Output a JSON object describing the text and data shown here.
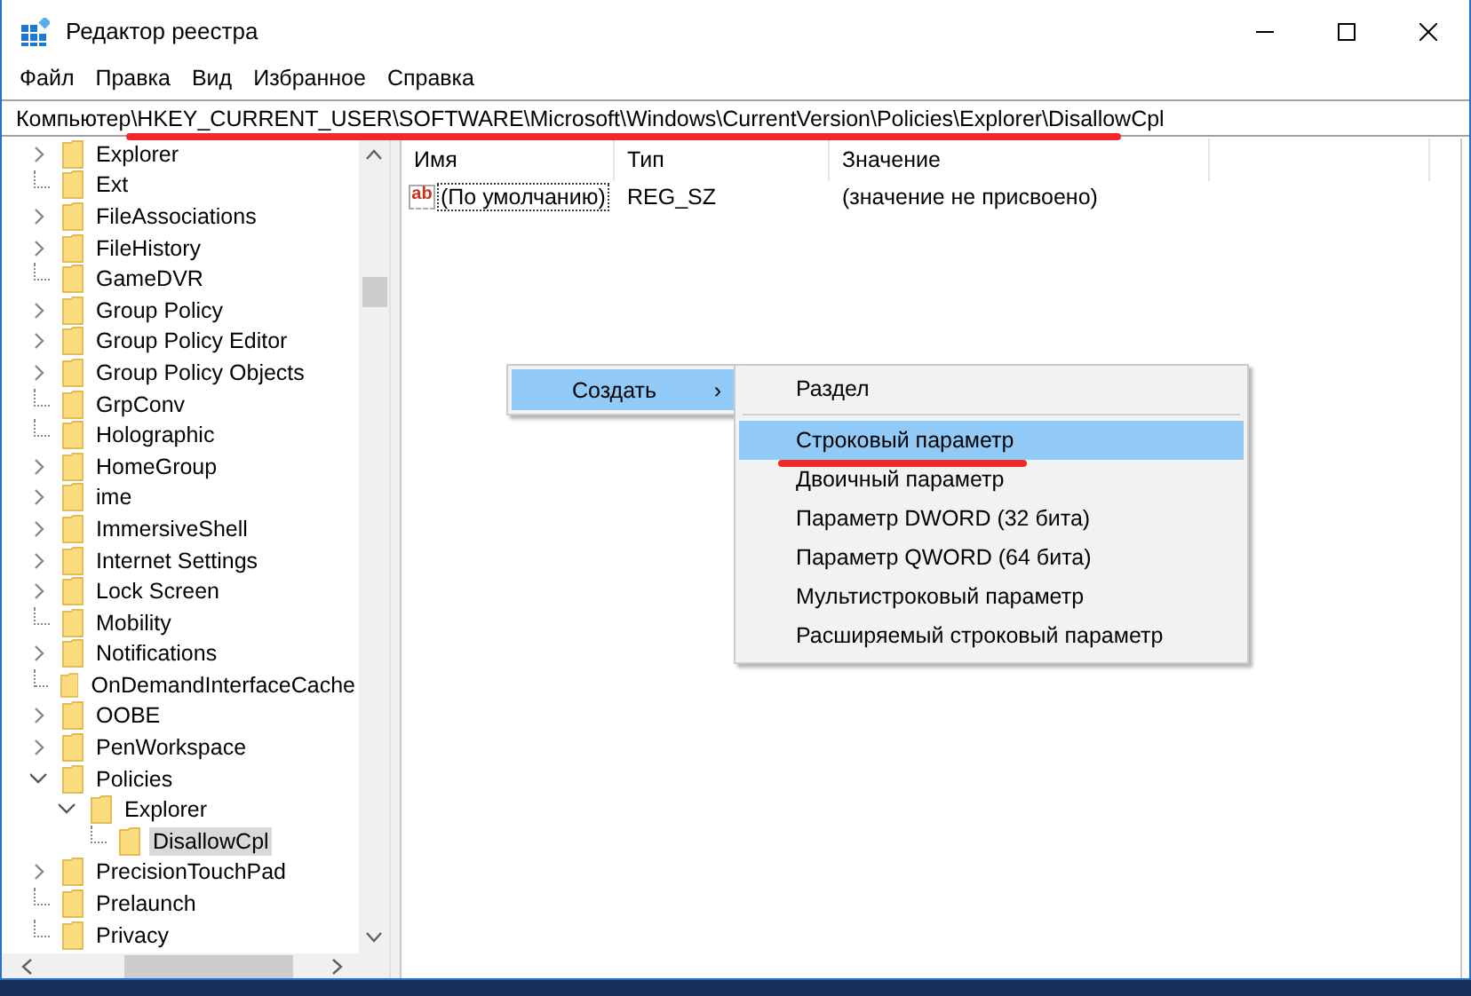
{
  "window": {
    "title": "Редактор реестра"
  },
  "menu": [
    "Файл",
    "Правка",
    "Вид",
    "Избранное",
    "Справка"
  ],
  "address": {
    "value": "Компьютер\\HKEY_CURRENT_USER\\SOFTWARE\\Microsoft\\Windows\\CurrentVersion\\Policies\\Explorer\\DisallowCpl",
    "underlined": true
  },
  "tree": [
    {
      "label": "Explorer",
      "expandable": true,
      "expanded": false,
      "selected": false
    },
    {
      "label": "Ext",
      "expandable": false,
      "selected": false
    },
    {
      "label": "FileAssociations",
      "expandable": true,
      "expanded": false,
      "selected": false
    },
    {
      "label": "FileHistory",
      "expandable": true,
      "expanded": false,
      "selected": false
    },
    {
      "label": "GameDVR",
      "expandable": false,
      "selected": false
    },
    {
      "label": "Group Policy",
      "expandable": true,
      "expanded": false,
      "selected": false
    },
    {
      "label": "Group Policy Editor",
      "expandable": true,
      "expanded": false,
      "selected": false
    },
    {
      "label": "Group Policy Objects",
      "expandable": true,
      "expanded": false,
      "selected": false
    },
    {
      "label": "GrpConv",
      "expandable": false,
      "selected": false
    },
    {
      "label": "Holographic",
      "expandable": false,
      "selected": false
    },
    {
      "label": "HomeGroup",
      "expandable": true,
      "expanded": false,
      "selected": false
    },
    {
      "label": "ime",
      "expandable": true,
      "expanded": false,
      "selected": false
    },
    {
      "label": "ImmersiveShell",
      "expandable": true,
      "expanded": false,
      "selected": false
    },
    {
      "label": "Internet Settings",
      "expandable": true,
      "expanded": false,
      "selected": false
    },
    {
      "label": "Lock Screen",
      "expandable": true,
      "expanded": false,
      "selected": false
    },
    {
      "label": "Mobility",
      "expandable": false,
      "selected": false
    },
    {
      "label": "Notifications",
      "expandable": true,
      "expanded": false,
      "selected": false
    },
    {
      "label": "OnDemandInterfaceCache",
      "expandable": false,
      "selected": false
    },
    {
      "label": "OOBE",
      "expandable": true,
      "expanded": false,
      "selected": false
    },
    {
      "label": "PenWorkspace",
      "expandable": true,
      "expanded": false,
      "selected": false
    },
    {
      "label": "Policies",
      "expandable": true,
      "expanded": true,
      "selected": false,
      "children": [
        {
          "label": "Explorer",
          "expandable": true,
          "expanded": true,
          "selected": false,
          "children": [
            {
              "label": "DisallowCpl",
              "expandable": false,
              "selected": true
            }
          ]
        }
      ]
    },
    {
      "label": "PrecisionTouchPad",
      "expandable": true,
      "expanded": false,
      "selected": false
    },
    {
      "label": "Prelaunch",
      "expandable": false,
      "selected": false
    },
    {
      "label": "Privacy",
      "expandable": false,
      "selected": false
    }
  ],
  "table": {
    "columns": [
      "Имя",
      "Тип",
      "Значение"
    ],
    "rows": [
      {
        "icon": "ab",
        "name": "(По умолчанию)",
        "type": "REG_SZ",
        "value": "(значение не присвоено)",
        "focused": true
      }
    ]
  },
  "context_menu": {
    "items": [
      {
        "label": "Создать",
        "arrow": "›",
        "selected": true
      }
    ],
    "submenu": [
      {
        "kind": "item",
        "label": "Раздел",
        "selected": false
      },
      {
        "kind": "separator"
      },
      {
        "kind": "item",
        "label": "Строковый параметр",
        "selected": true,
        "underlined": true
      },
      {
        "kind": "item",
        "label": "Двоичный параметр",
        "selected": false
      },
      {
        "kind": "item",
        "label": "Параметр DWORD (32 бита)",
        "selected": false
      },
      {
        "kind": "item",
        "label": "Параметр QWORD (64 бита)",
        "selected": false
      },
      {
        "kind": "item",
        "label": "Мультистроковый параметр",
        "selected": false
      },
      {
        "kind": "item",
        "label": "Расширяемый строковый параметр",
        "selected": false
      }
    ]
  }
}
